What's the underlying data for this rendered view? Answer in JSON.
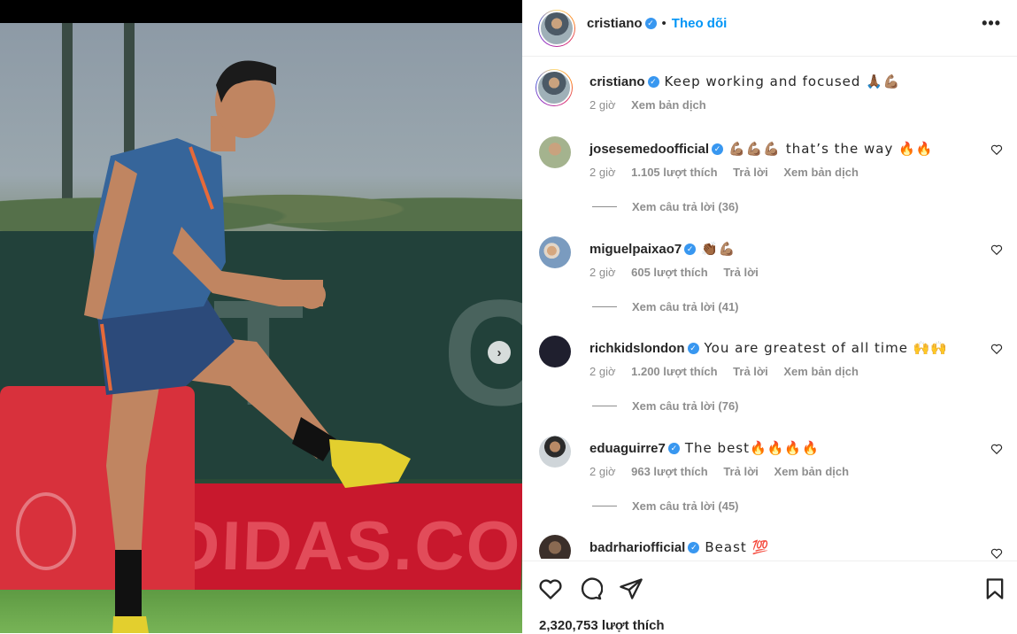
{
  "post": {
    "author": "cristiano",
    "follow_label": "Theo dõi",
    "dot": "•",
    "more": "•••",
    "next_label": "›",
    "ad_text": "ADIDAS.COM",
    "caption": "Keep working and focused 🙏🏾💪🏽",
    "caption_time": "2 giờ",
    "caption_translate": "Xem bản dịch",
    "likes": "2,320,753 lượt thích"
  },
  "comments": [
    {
      "user": "josesemedoofficial",
      "text": "💪🏽💪🏽💪🏽 that’s the way 🔥🔥",
      "time": "2 giờ",
      "likes": "1.105 lượt thích",
      "reply": "Trả lời",
      "translate": "Xem bản dịch",
      "view_replies": "Xem câu trả lời (36)"
    },
    {
      "user": "miguelpaixao7",
      "text": "👏🏾💪🏽",
      "time": "2 giờ",
      "likes": "605 lượt thích",
      "reply": "Trả lời",
      "translate": "",
      "view_replies": "Xem câu trả lời (41)"
    },
    {
      "user": "richkidslondon",
      "text": "You are greatest of all time 🙌🙌",
      "time": "2 giờ",
      "likes": "1.200 lượt thích",
      "reply": "Trả lời",
      "translate": "Xem bản dịch",
      "view_replies": "Xem câu trả lời (76)"
    },
    {
      "user": "eduaguirre7",
      "text": "The best🔥🔥🔥🔥",
      "time": "2 giờ",
      "likes": "963 lượt thích",
      "reply": "Trả lời",
      "translate": "Xem bản dịch",
      "view_replies": "Xem câu trả lời (45)"
    },
    {
      "user": "badrhariofficial",
      "text": "Beast 💯",
      "time": "",
      "likes": "",
      "reply": "",
      "translate": "",
      "view_replies": ""
    }
  ],
  "colors": {
    "link_blue": "#0095f6",
    "verified_blue": "#3897f0",
    "meta_gray": "#8e8e8e"
  },
  "icons": {
    "verified": "verified-badge-icon",
    "like": "heart-icon",
    "comment": "comment-bubble-icon",
    "share": "paper-plane-icon",
    "save": "bookmark-icon",
    "next": "chevron-right-icon",
    "more": "ellipsis-icon"
  }
}
